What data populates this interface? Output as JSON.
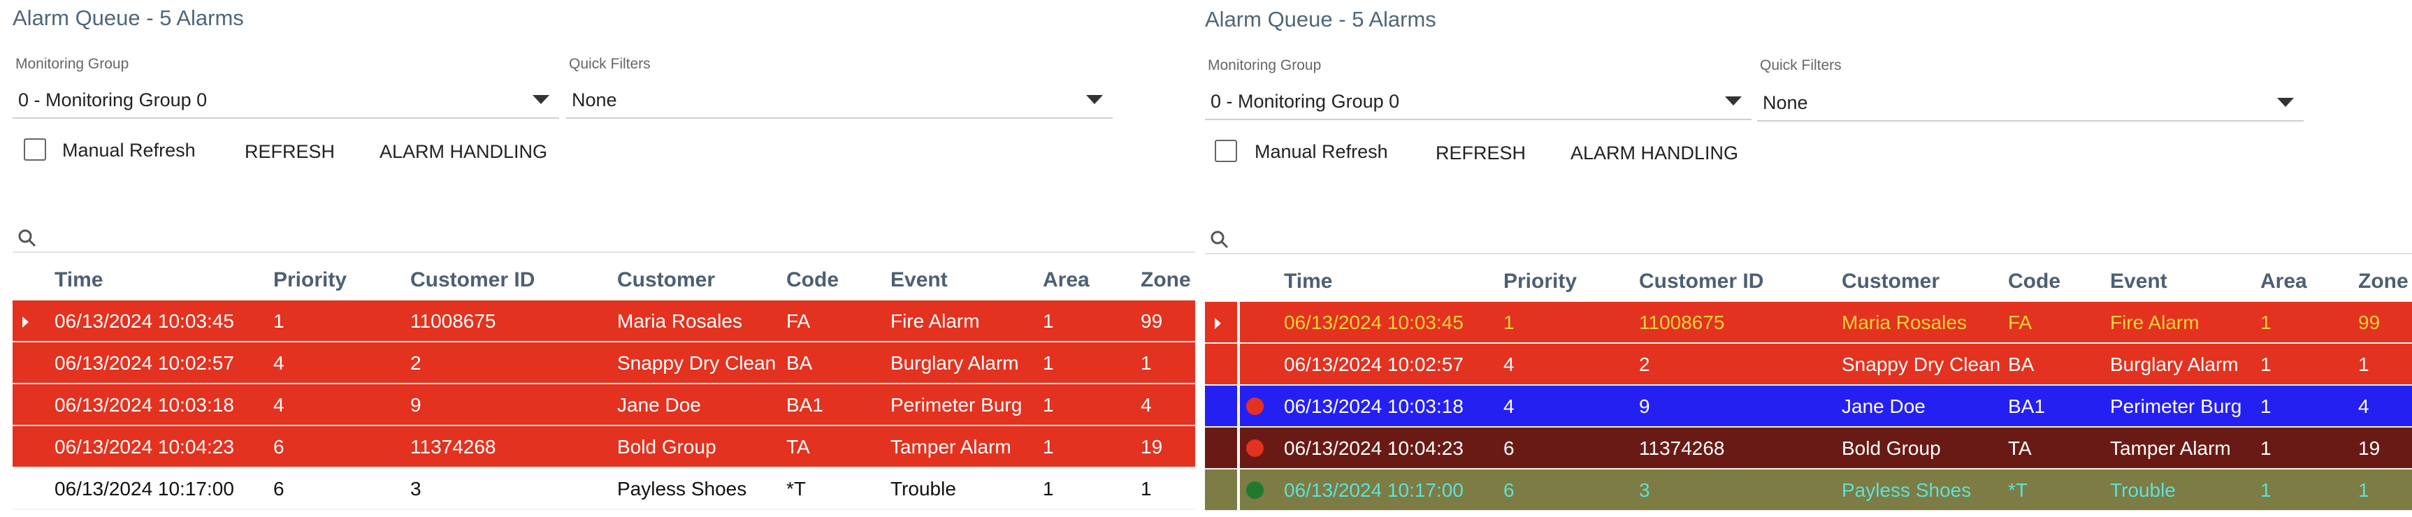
{
  "left": {
    "title": "Alarm Queue - 5 Alarms",
    "monitoring_group_label": "Monitoring Group",
    "monitoring_group_value": "0 - Monitoring Group 0",
    "quick_filters_label": "Quick Filters",
    "quick_filters_value": "None",
    "manual_refresh_label": "Manual Refresh",
    "refresh_label": "REFRESH",
    "alarm_handling_label": "ALARM HANDLING",
    "columns": [
      "Time",
      "Priority",
      "Customer ID",
      "Customer",
      "Code",
      "Event",
      "Area",
      "Zone"
    ],
    "rows": [
      {
        "time": "06/13/2024 10:03:45",
        "priority": "1",
        "customer_id": "11008675",
        "customer": "Maria Rosales",
        "code": "FA",
        "event": "Fire Alarm",
        "area": "1",
        "zone": "99"
      },
      {
        "time": "06/13/2024 10:02:57",
        "priority": "4",
        "customer_id": "2",
        "customer": "Snappy Dry Clean",
        "code": "BA",
        "event": "Burglary Alarm",
        "area": "1",
        "zone": "1"
      },
      {
        "time": "06/13/2024 10:03:18",
        "priority": "4",
        "customer_id": "9",
        "customer": "Jane Doe",
        "code": "BA1",
        "event": "Perimeter Burg",
        "area": "1",
        "zone": "4"
      },
      {
        "time": "06/13/2024 10:04:23",
        "priority": "6",
        "customer_id": "11374268",
        "customer": "Bold Group",
        "code": "TA",
        "event": "Tamper Alarm",
        "area": "1",
        "zone": "19"
      },
      {
        "time": "06/13/2024 10:17:00",
        "priority": "6",
        "customer_id": "3",
        "customer": "Payless Shoes",
        "code": "*T",
        "event": "Trouble",
        "area": "1",
        "zone": "1"
      }
    ],
    "row_styles": [
      {
        "bg": "#e3321f",
        "fg": "#ffffff"
      },
      {
        "bg": "#e3321f",
        "fg": "#ffffff"
      },
      {
        "bg": "#e3321f",
        "fg": "#ffffff"
      },
      {
        "bg": "#e3321f",
        "fg": "#ffffff"
      },
      {
        "bg": "#ffffff",
        "fg": "#111111"
      }
    ]
  },
  "right": {
    "title": "Alarm Queue - 5 Alarms",
    "monitoring_group_label": "Monitoring Group",
    "monitoring_group_value": "0 - Monitoring Group 0",
    "quick_filters_label": "Quick Filters",
    "quick_filters_value": "None",
    "manual_refresh_label": "Manual Refresh",
    "refresh_label": "REFRESH",
    "alarm_handling_label": "ALARM HANDLING",
    "columns": [
      "Time",
      "Priority",
      "Customer ID",
      "Customer",
      "Code",
      "Event",
      "Area",
      "Zone"
    ],
    "rows": [
      {
        "time": "06/13/2024 10:03:45",
        "priority": "1",
        "customer_id": "11008675",
        "customer": "Maria Rosales",
        "code": "FA",
        "event": "Fire Alarm",
        "area": "1",
        "zone": "99"
      },
      {
        "time": "06/13/2024 10:02:57",
        "priority": "4",
        "customer_id": "2",
        "customer": "Snappy Dry Clean",
        "code": "BA",
        "event": "Burglary Alarm",
        "area": "1",
        "zone": "1"
      },
      {
        "time": "06/13/2024 10:03:18",
        "priority": "4",
        "customer_id": "9",
        "customer": "Jane Doe",
        "code": "BA1",
        "event": "Perimeter Burg",
        "area": "1",
        "zone": "4"
      },
      {
        "time": "06/13/2024 10:04:23",
        "priority": "6",
        "customer_id": "11374268",
        "customer": "Bold Group",
        "code": "TA",
        "event": "Tamper Alarm",
        "area": "1",
        "zone": "19"
      },
      {
        "time": "06/13/2024 10:17:00",
        "priority": "6",
        "customer_id": "3",
        "customer": "Payless Shoes",
        "code": "*T",
        "event": "Trouble",
        "area": "1",
        "zone": "1"
      }
    ],
    "row_styles": [
      {
        "bg": "#e3321f",
        "fg": "#f6d33c",
        "dot": "#e3321f"
      },
      {
        "bg": "#e3321f",
        "fg": "#ffffff",
        "dot": "#e3321f"
      },
      {
        "bg": "#2520f2",
        "fg": "#ffffff",
        "dot": "#e3321f"
      },
      {
        "bg": "#6a1a14",
        "fg": "#ffffff",
        "dot": "#e3321f"
      },
      {
        "bg": "#7c7c44",
        "fg": "#5fe0d6",
        "dot": "#1f7a2e"
      }
    ]
  }
}
